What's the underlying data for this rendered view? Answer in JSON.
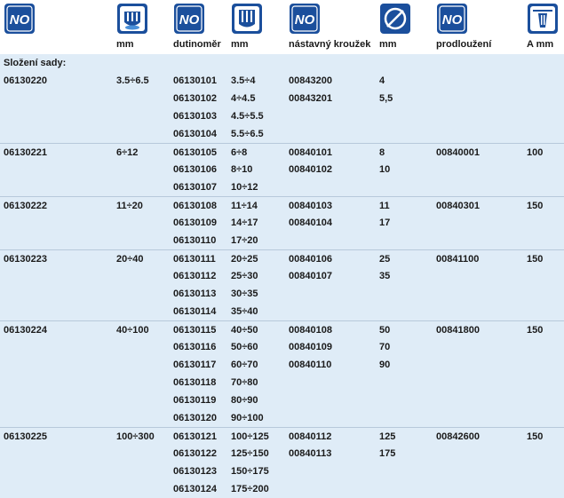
{
  "colors": {
    "icon_blue": "#1b4f9c",
    "row_bg": "#dfecf7",
    "separator": "#b7c9db"
  },
  "icons": [
    "no-logo-icon",
    "socket-icon",
    "no-logo-icon",
    "socket-icon",
    "no-logo-icon",
    "diameter-icon",
    "no-logo-icon",
    "a-dimension-icon"
  ],
  "no_text": "NO",
  "headers": [
    "",
    "mm",
    "dutinoměr",
    "mm",
    "nástavný kroužek",
    "mm",
    "prodloužení",
    "A mm"
  ],
  "set_label": "Složení sady:",
  "rows": [
    [
      "06130220",
      "3.5÷6.5",
      "06130101",
      "3.5÷4",
      "00843200",
      "4",
      "",
      ""
    ],
    [
      "",
      "",
      "06130102",
      "4÷4.5",
      "00843201",
      "5,5",
      "",
      ""
    ],
    [
      "",
      "",
      "06130103",
      "4.5÷5.5",
      "",
      "",
      "",
      ""
    ],
    [
      "",
      "",
      "06130104",
      "5.5÷6.5",
      "",
      "",
      "",
      ""
    ],
    [
      "06130221",
      "6÷12",
      "06130105",
      "6÷8",
      "00840101",
      "8",
      "00840001",
      "100"
    ],
    [
      "",
      "",
      "06130106",
      "8÷10",
      "00840102",
      "10",
      "",
      ""
    ],
    [
      "",
      "",
      "06130107",
      "10÷12",
      "",
      "",
      "",
      ""
    ],
    [
      "06130222",
      "11÷20",
      "06130108",
      "11÷14",
      "00840103",
      "11",
      "00840301",
      "150"
    ],
    [
      "",
      "",
      "06130109",
      "14÷17",
      "00840104",
      "17",
      "",
      ""
    ],
    [
      "",
      "",
      "06130110",
      "17÷20",
      "",
      "",
      "",
      ""
    ],
    [
      "06130223",
      "20÷40",
      "06130111",
      "20÷25",
      "00840106",
      "25",
      "00841100",
      "150"
    ],
    [
      "",
      "",
      "06130112",
      "25÷30",
      "00840107",
      "35",
      "",
      ""
    ],
    [
      "",
      "",
      "06130113",
      "30÷35",
      "",
      "",
      "",
      ""
    ],
    [
      "",
      "",
      "06130114",
      "35÷40",
      "",
      "",
      "",
      ""
    ],
    [
      "06130224",
      "40÷100",
      "06130115",
      "40÷50",
      "00840108",
      "50",
      "00841800",
      "150"
    ],
    [
      "",
      "",
      "06130116",
      "50÷60",
      "00840109",
      "70",
      "",
      ""
    ],
    [
      "",
      "",
      "06130117",
      "60÷70",
      "00840110",
      "90",
      "",
      ""
    ],
    [
      "",
      "",
      "06130118",
      "70÷80",
      "",
      "",
      "",
      ""
    ],
    [
      "",
      "",
      "06130119",
      "80÷90",
      "",
      "",
      "",
      ""
    ],
    [
      "",
      "",
      "06130120",
      "90÷100",
      "",
      "",
      "",
      ""
    ],
    [
      "06130225",
      "100÷300",
      "06130121",
      "100÷125",
      "00840112",
      "125",
      "00842600",
      "150"
    ],
    [
      "",
      "",
      "06130122",
      "125÷150",
      "00840113",
      "175",
      "",
      ""
    ],
    [
      "",
      "",
      "06130123",
      "150÷175",
      "",
      "",
      "",
      ""
    ],
    [
      "",
      "",
      "06130124",
      "175÷200",
      "",
      "",
      "",
      ""
    ]
  ]
}
